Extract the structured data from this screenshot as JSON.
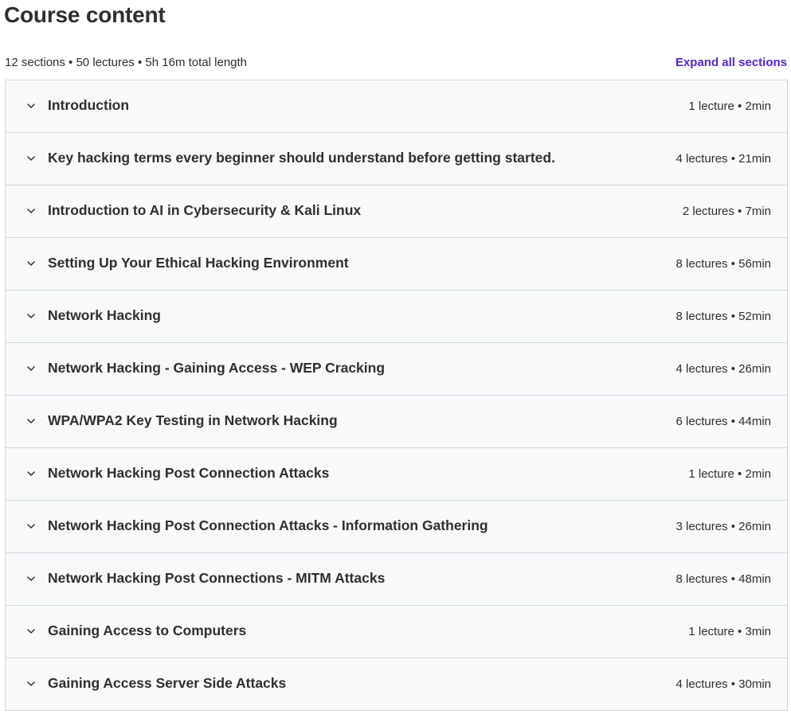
{
  "header": {
    "title": "Course content",
    "summary": "12 sections • 50 lectures • 5h 16m total length",
    "expand_label": "Expand all sections"
  },
  "icons": {
    "section_toggle": "chevron-down-icon"
  },
  "colors": {
    "text": "#2d2f31",
    "link": "#5624d0",
    "section_bg": "#f7f9fa",
    "border": "#d1d7dc"
  },
  "sections": [
    {
      "title": "Introduction",
      "meta": "1 lecture • 2min"
    },
    {
      "title": "Key hacking terms every beginner should understand before getting started.",
      "meta": "4 lectures • 21min"
    },
    {
      "title": "Introduction to AI in Cybersecurity & Kali Linux",
      "meta": "2 lectures • 7min"
    },
    {
      "title": "Setting Up Your Ethical Hacking Environment",
      "meta": "8 lectures • 56min"
    },
    {
      "title": "Network Hacking",
      "meta": "8 lectures • 52min"
    },
    {
      "title": "Network Hacking - Gaining Access - WEP Cracking",
      "meta": "4 lectures • 26min"
    },
    {
      "title": "WPA/WPA2 Key Testing in Network Hacking",
      "meta": "6 lectures • 44min"
    },
    {
      "title": "Network Hacking Post Connection Attacks",
      "meta": "1 lecture • 2min"
    },
    {
      "title": "Network Hacking Post Connection Attacks - Information Gathering",
      "meta": "3 lectures • 26min"
    },
    {
      "title": "Network Hacking Post Connections - MITM Attacks",
      "meta": "8 lectures • 48min"
    },
    {
      "title": "Gaining Access to Computers",
      "meta": "1 lecture • 3min"
    },
    {
      "title": "Gaining Access Server Side Attacks",
      "meta": "4 lectures • 30min"
    }
  ]
}
